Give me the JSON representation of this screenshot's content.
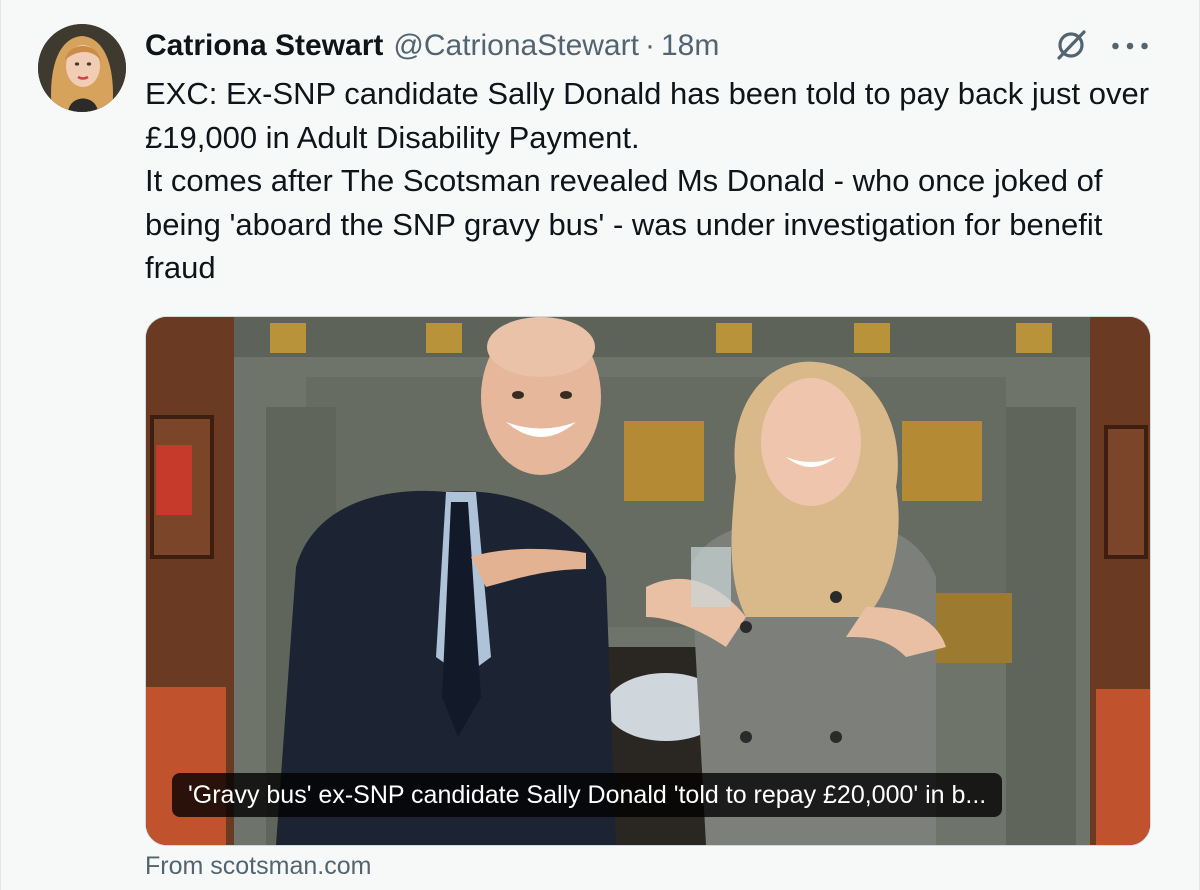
{
  "author": {
    "name": "Catriona Stewart",
    "handle": "@CatrionaStewart",
    "separator": "·",
    "time": "18m",
    "avatar_icon": "profile-photo"
  },
  "tweet": {
    "lines": [
      "EXC: Ex-SNP candidate Sally Donald has been told to pay back just over £19,000 in Adult Disability Payment.",
      "It comes after The Scotsman revealed Ms Donald - who once joked of being 'aboard the SNP gravy bus' - was under investigation for benefit fraud"
    ]
  },
  "card": {
    "caption": "'Gravy bus' ex-SNP candidate Sally Donald 'told to repay £20,000' in b...",
    "source": "From scotsman.com"
  },
  "icons": {
    "grok": "grok-icon",
    "more": "more-icon"
  },
  "colors": {
    "background": "#f7f9f9",
    "text": "#0f1419",
    "secondary": "#536471"
  }
}
